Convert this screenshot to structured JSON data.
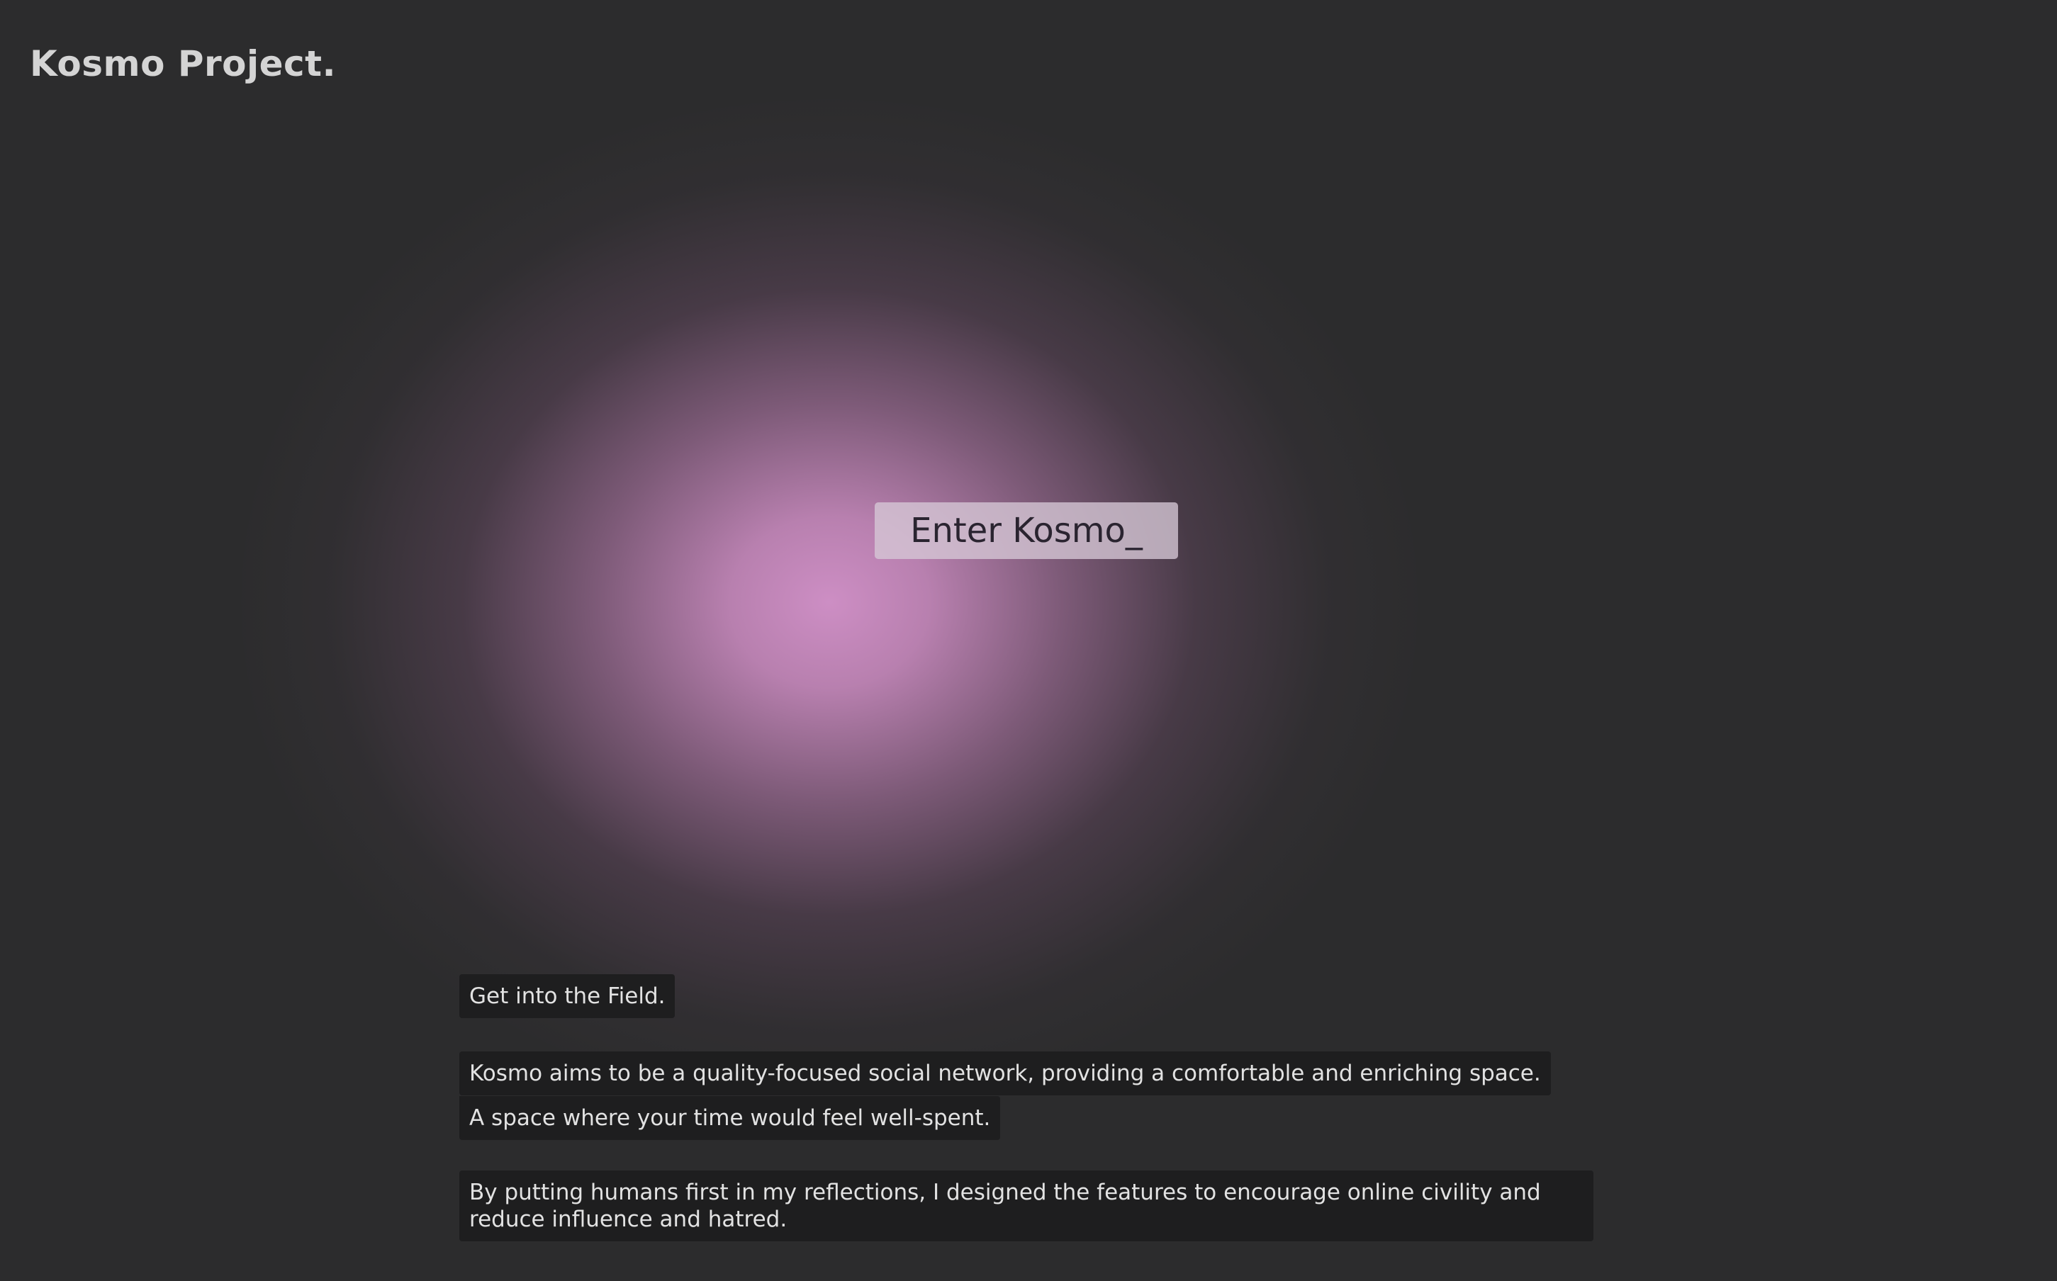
{
  "header": {
    "site_title": "Kosmo Project."
  },
  "hero": {
    "enter_label": "Enter Kosmo_",
    "glow_color": "#c98fc3"
  },
  "intro": {
    "heading": "Get into the Field.",
    "line_1": "Kosmo aims to be a quality-focused social network, providing a comfortable and enriching space.",
    "line_2": "A space where your time would feel well-spent.",
    "paragraph": "By putting humans first in my reflections, I designed the features to encourage online civility and reduce influence and hatred."
  },
  "colors": {
    "background": "#2c2c2d",
    "text_box_bg": "#1e1e1f",
    "text": "#e2e2e2",
    "title": "#d4d4d4"
  }
}
